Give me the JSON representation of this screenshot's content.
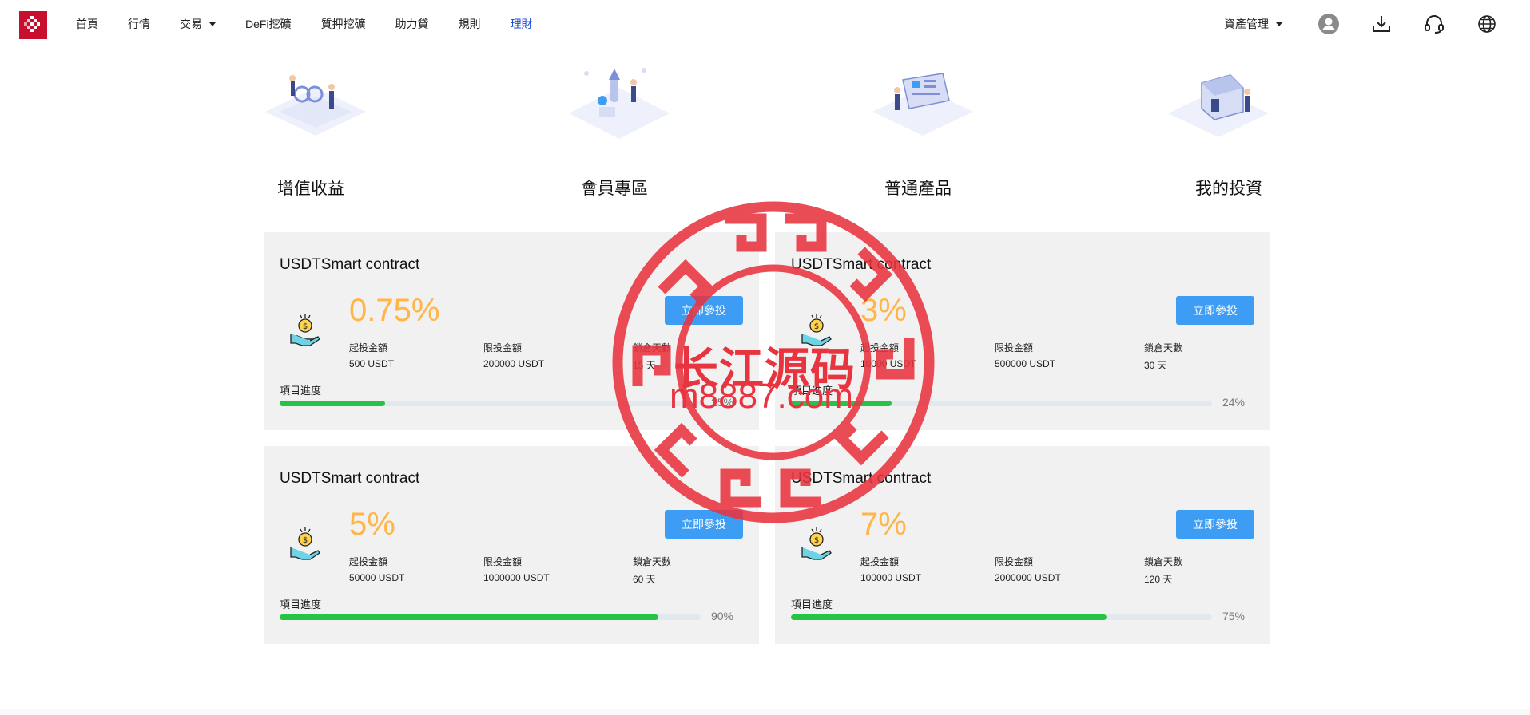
{
  "nav": {
    "items": [
      {
        "label": "首頁",
        "dropdown": false,
        "active": false
      },
      {
        "label": "行情",
        "dropdown": false,
        "active": false
      },
      {
        "label": "交易",
        "dropdown": true,
        "active": false
      },
      {
        "label": "DeFi挖礦",
        "dropdown": false,
        "active": false
      },
      {
        "label": "質押挖礦",
        "dropdown": false,
        "active": false
      },
      {
        "label": "助力貸",
        "dropdown": false,
        "active": false
      },
      {
        "label": "規則",
        "dropdown": false,
        "active": false
      },
      {
        "label": "理財",
        "dropdown": false,
        "active": true
      }
    ],
    "asset_menu": "資產管理",
    "icons": [
      "user-icon",
      "download-icon",
      "headset-icon",
      "globe-icon"
    ]
  },
  "categories": [
    {
      "label": "增值收益",
      "icon": "value-growth-illustration"
    },
    {
      "label": "會員專區",
      "icon": "member-zone-illustration"
    },
    {
      "label": "普通產品",
      "icon": "standard-products-illustration"
    },
    {
      "label": "我的投資",
      "icon": "my-investment-illustration"
    }
  ],
  "products": [
    {
      "title": "USDTSmart contract",
      "rate": "0.75%",
      "button": "立即參投",
      "min_label": "起投金額",
      "min_value": "500 USDT",
      "max_label": "限投金額",
      "max_value": "200000 USDT",
      "lock_label": "鎖倉天數",
      "lock_value": "15 天",
      "progress_label": "項目進度",
      "progress": 25,
      "progress_text": "25%"
    },
    {
      "title": "USDTSmart contract",
      "rate": "3%",
      "button": "立即參投",
      "min_label": "起投金額",
      "min_value": "10000 USDT",
      "max_label": "限投金額",
      "max_value": "500000 USDT",
      "lock_label": "鎖倉天數",
      "lock_value": "30 天",
      "progress_label": "項目進度",
      "progress": 24,
      "progress_text": "24%"
    },
    {
      "title": "USDTSmart contract",
      "rate": "5%",
      "button": "立即參投",
      "min_label": "起投金額",
      "min_value": "50000 USDT",
      "max_label": "限投金額",
      "max_value": "1000000 USDT",
      "lock_label": "鎖倉天數",
      "lock_value": "60 天",
      "progress_label": "項目進度",
      "progress": 90,
      "progress_text": "90%"
    },
    {
      "title": "USDTSmart contract",
      "rate": "7%",
      "button": "立即參投",
      "min_label": "起投金額",
      "min_value": "100000 USDT",
      "max_label": "限投金額",
      "max_value": "2000000 USDT",
      "lock_label": "鎖倉天數",
      "lock_value": "120 天",
      "progress_label": "項目進度",
      "progress": 75,
      "progress_text": "75%"
    }
  ],
  "watermark": {
    "title": "长江源码",
    "url": "m8887.com"
  },
  "colors": {
    "brand": "#c8102e",
    "accent_button": "#3d9df5",
    "rate": "#ffb547",
    "progress": "#27c346",
    "active_nav": "#1d4ed8",
    "watermark": "#e8343f"
  }
}
